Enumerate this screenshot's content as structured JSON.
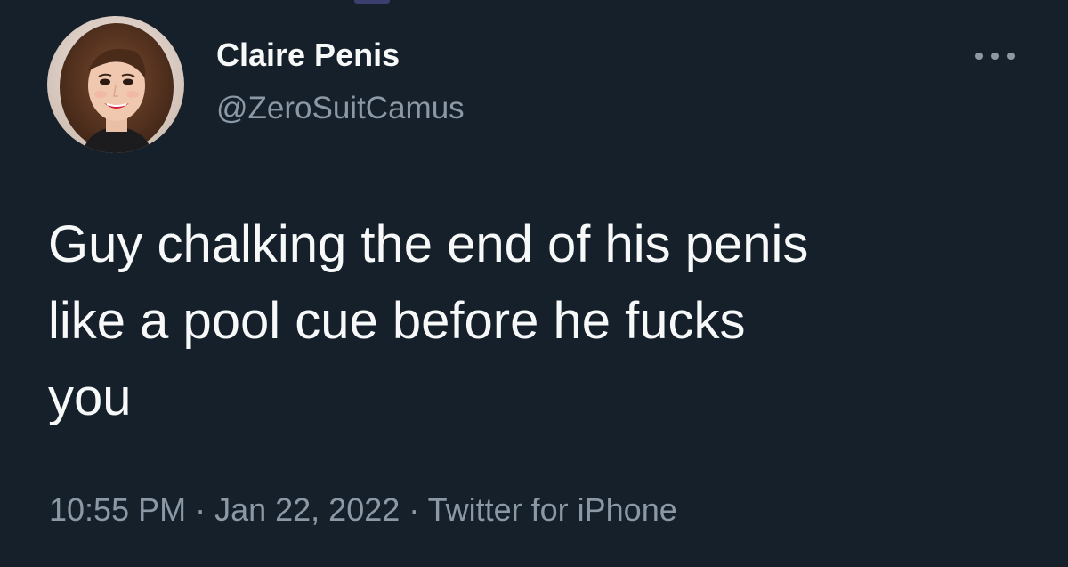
{
  "tweet": {
    "author": {
      "display_name": "Claire Penis",
      "handle": "@ZeroSuitCamus",
      "avatar_icon": "profile-photo"
    },
    "more_icon": "ellipsis-icon",
    "text": "Guy chalking the end of his penis\nlike a pool cue before he fucks\nyou",
    "meta": {
      "time": "10:55 PM",
      "separator": " · ",
      "date": "Jan 22, 2022",
      "source": "Twitter for iPhone"
    }
  },
  "colors": {
    "background": "#15202b",
    "primary_text": "#f7f9f9",
    "secondary_text": "#8b98a5"
  }
}
